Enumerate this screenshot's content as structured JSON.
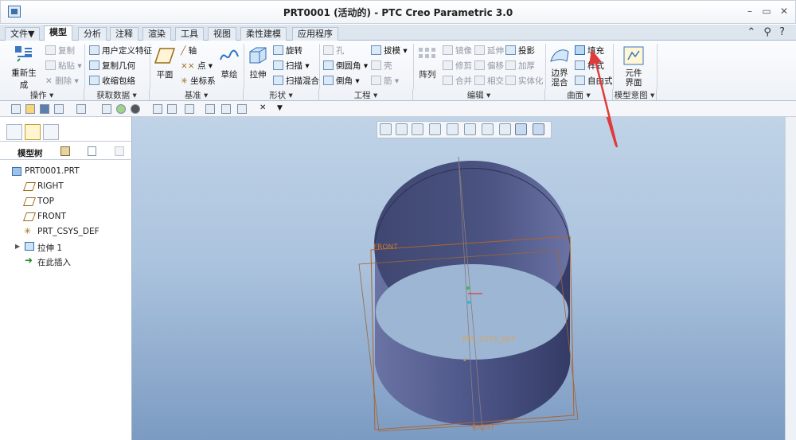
{
  "window": {
    "title": "PRT0001 (活动的) - PTC Creo Parametric 3.0",
    "minimize": "–",
    "restore": "▭",
    "close": "✕"
  },
  "tabs": [
    "文件▼",
    "模型",
    "分析",
    "注释",
    "渲染",
    "工具",
    "视图",
    "柔性建模",
    "应用程序"
  ],
  "help_icons": {
    "arrow": "⌃",
    "search": "⚲",
    "help": "?"
  },
  "ribbon": {
    "operations": {
      "regenerate": "重新生成",
      "copy": "复制",
      "paste": "粘贴 ▾",
      "delete": "✕ 删除 ▾"
    },
    "get_data": {
      "udf": "用户定义特征",
      "copy_geom": "复制几何",
      "shrinkwrap": "收缩包络"
    },
    "datum": {
      "plane": "平面",
      "axis": "轴",
      "point": "点 ▾",
      "csys": "坐标系",
      "sketch": "草绘"
    },
    "shapes": {
      "extrude": "拉伸",
      "revolve": "旋转",
      "sweep": "扫描 ▾",
      "swept_blend": "扫描混合"
    },
    "engineering": {
      "hole": "孔",
      "round": "倒圆角 ▾",
      "chamfer": "倒角 ▾",
      "draft": "拔模 ▾",
      "shell": "壳",
      "rib": "筋 ▾"
    },
    "editing": {
      "pattern": "阵列",
      "mirror": "镜像",
      "extend": "延伸",
      "project": "投影",
      "trim": "修剪",
      "offset": "偏移",
      "thicken": "加厚",
      "merge": "合并",
      "intersect": "相交",
      "solidify": "实体化"
    },
    "surfaces": {
      "boundary_blend": "边界\n混合",
      "fill": "填充",
      "style": "样式",
      "freestyle": "自由式"
    },
    "model_intent": {
      "component_interface": "元件\n界面"
    },
    "groups": [
      "操作 ▾",
      "获取数据 ▾",
      "基准 ▾",
      "形状 ▾",
      "工程 ▾",
      "编辑 ▾",
      "曲面 ▾",
      "模型意图 ▾"
    ]
  },
  "model_tree": {
    "title": "模型树",
    "items": [
      "PRT0001.PRT",
      "RIGHT",
      "TOP",
      "FRONT",
      "PRT_CSYS_DEF",
      "拉伸 1",
      "在此插入"
    ]
  },
  "viewport": {
    "label_front": "FRONT",
    "label_csys": "PRT_CSYS_DEF",
    "label_right": "RIGHT",
    "axis_z": "z"
  },
  "colors": {
    "accent": "#e03a3a",
    "datum": "#b0642e",
    "model": "#4a5584"
  }
}
